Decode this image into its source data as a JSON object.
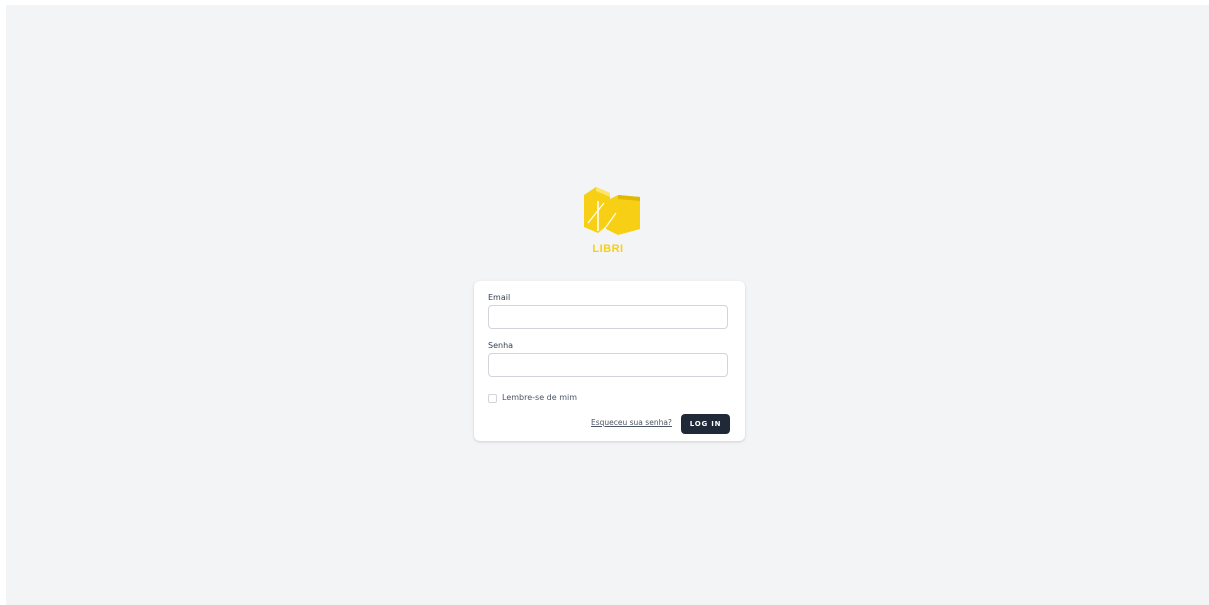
{
  "brand": {
    "name": "LIBRI",
    "logo_icon": "books-icon",
    "color": "#f7cf14"
  },
  "form": {
    "email_label": "Email",
    "email_value": "",
    "password_label": "Senha",
    "password_value": "",
    "remember_label": "Lembre-se de mim",
    "remember_checked": false,
    "forgot_link": "Esqueceu sua senha?",
    "submit_label": "LOG IN"
  },
  "colors": {
    "background": "#f3f4f6",
    "card": "#ffffff",
    "button": "#1f2937",
    "button_text": "#ffffff"
  }
}
